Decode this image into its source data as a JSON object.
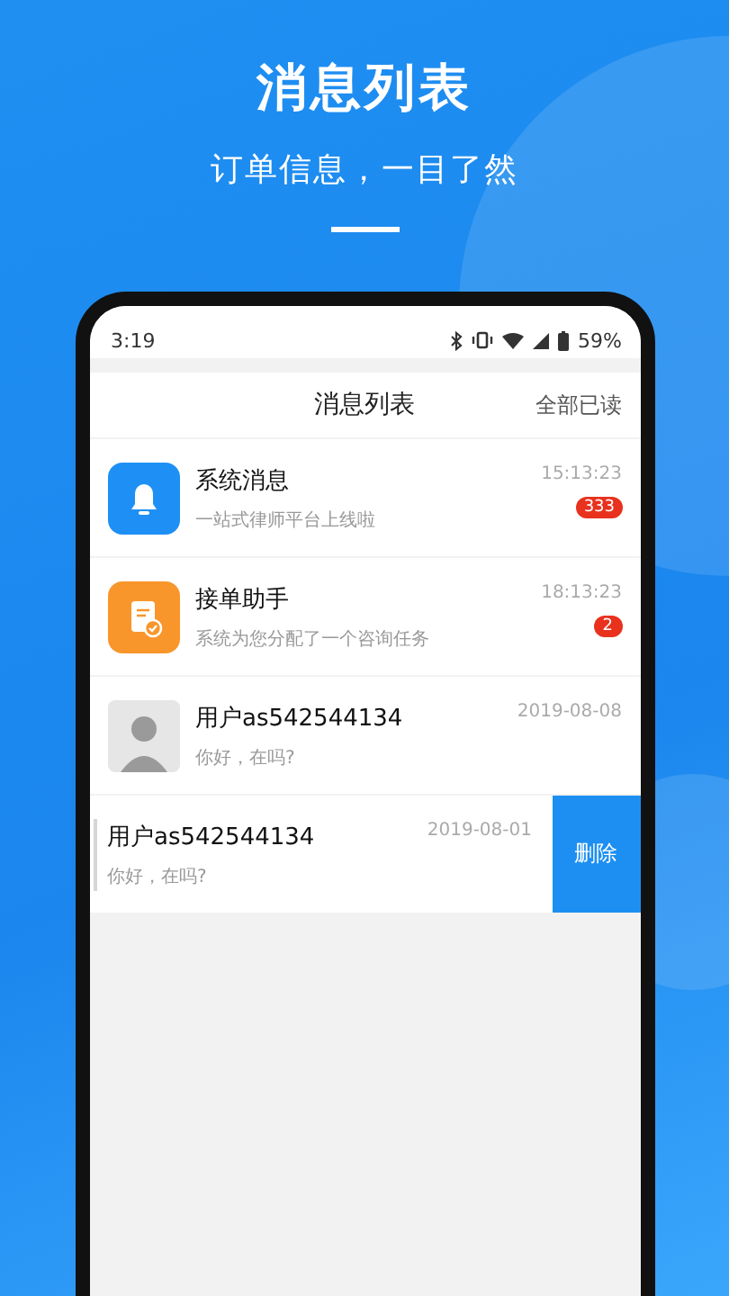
{
  "promo": {
    "title": "消息列表",
    "subtitle": "订单信息，一目了然"
  },
  "status_bar": {
    "time": "3:19",
    "battery": "59%"
  },
  "header": {
    "title": "消息列表",
    "action": "全部已读"
  },
  "messages": [
    {
      "kind": "bell",
      "name": "系统消息",
      "preview": "一站式律师平台上线啦",
      "time": "15:13:23",
      "badge": "333",
      "swiped": false
    },
    {
      "kind": "task",
      "name": "接单助手",
      "preview": "系统为您分配了一个咨询任务",
      "time": "18:13:23",
      "badge": "2",
      "swiped": false
    },
    {
      "kind": "photo",
      "name": "用户as542544134",
      "preview": "你好，在吗?",
      "time": "2019-08-08",
      "swiped": false
    },
    {
      "kind": "photo",
      "name": "用户as542544134",
      "preview": "你好，在吗?",
      "time": "2019-08-01",
      "swiped": true,
      "action": "删除"
    }
  ]
}
